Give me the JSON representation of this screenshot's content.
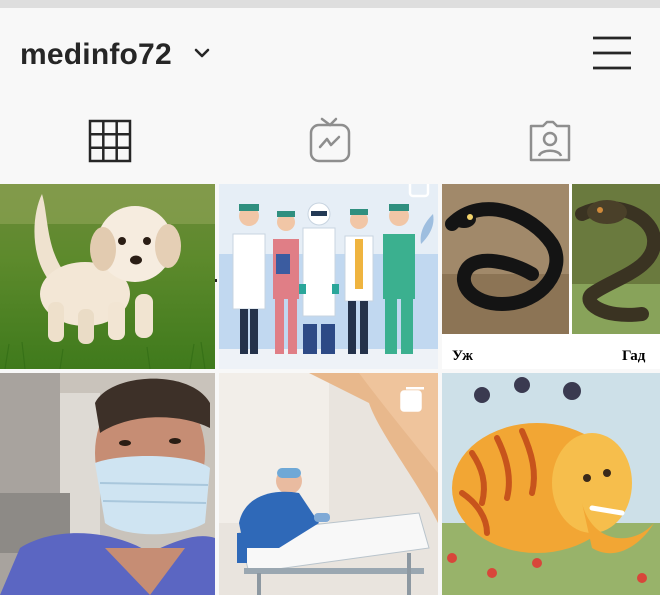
{
  "profile": {
    "username": "medinfo72"
  },
  "icons": {
    "dropdown": "chevron-down-icon",
    "menu": "hamburger-menu-icon",
    "grid_tab": "grid-icon",
    "igtv_tab": "igtv-icon",
    "tagged_tab": "tagged-user-icon",
    "multi_post": "multiple-photos-icon"
  },
  "posts": [
    {
      "subject": "puppy"
    },
    {
      "subject": "medical-staff-illustration",
      "multi": true
    },
    {
      "subject": "snakes-comparison",
      "labels": [
        "Уж",
        "Гад"
      ]
    },
    {
      "subject": "doctor-in-mask"
    },
    {
      "subject": "nurse-making-bed",
      "multi": true
    },
    {
      "subject": "elephant-painting"
    }
  ],
  "colors": {
    "text": "#262626",
    "background": "#f8f8f8"
  }
}
